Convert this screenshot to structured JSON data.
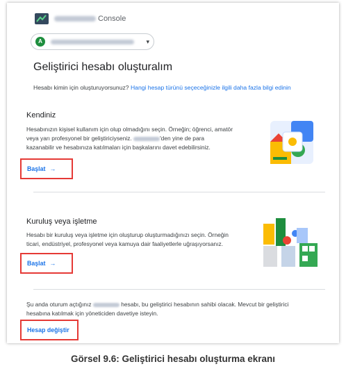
{
  "header": {
    "brand_suffix": "Console",
    "account_avatar_letter": "A"
  },
  "page": {
    "title": "Geliştirici hesabı oluşturalım",
    "intro_text": "Hesabı kimin için oluşturuyorsunuz?",
    "intro_link": "Hangi hesap türünü seçeceğinizle ilgili daha fazla bilgi edinin"
  },
  "personal": {
    "title": "Kendiniz",
    "desc_line1": "Hesabınızın kişisel kullanım için olup olmadığını seçin. Örneğin; öğrenci, amatör",
    "desc_line2": "veya yarı profesyonel bir geliştiriciyseniz.",
    "desc_line2b": "'den yine de para",
    "desc_line3": "kazanabilir ve hesabınıza katılmaları için başkalarını davet edebilirsiniz.",
    "action_label": "Başlat",
    "arrow": "→"
  },
  "organization": {
    "title": "Kuruluş veya işletme",
    "desc_line1": "Hesabı bir kuruluş veya işletme için oluşturup oluşturmadığınızı seçin. Örneğin",
    "desc_line2": "ticari, endüstriyel, profesyonel veya kamuya dair faaliyetlerle uğraşıyorsanız.",
    "action_label": "Başlat",
    "arrow": "→"
  },
  "switch": {
    "desc_line1a": "Şu anda oturum açtığınız",
    "desc_line1b": "hesabı, bu geliştirici hesabının sahibi olacak. Mevcut bir geliştirici",
    "desc_line2": "hesabına katılmak için yöneticiden davetiye isteyin.",
    "action_label": "Hesap değiştir"
  },
  "caption": "Görsel 9.6: Geliştirici hesabı oluşturma ekranı",
  "colors": {
    "link": "#1a73e8",
    "highlight_box": "#e53935",
    "avatar": "#1e8e3e"
  }
}
